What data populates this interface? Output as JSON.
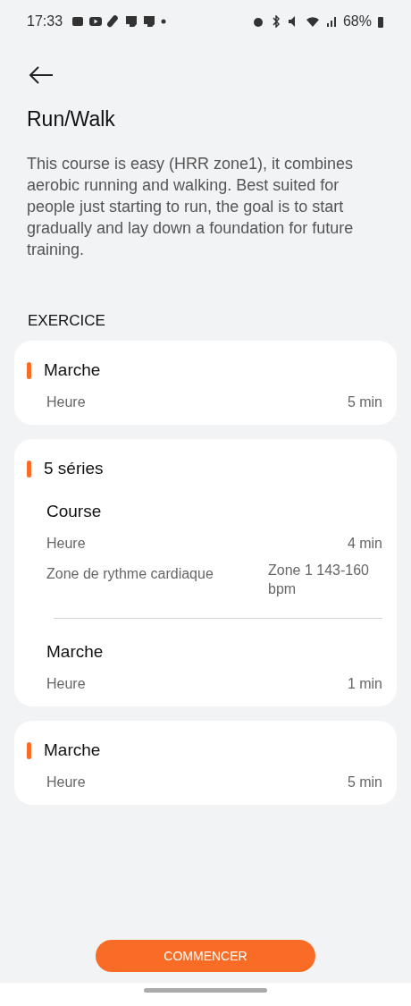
{
  "status_bar": {
    "time": "17:33",
    "battery": "68%"
  },
  "title": "Run/Walk",
  "description": "This course is easy (HRR zone1), it combines aerobic running and walking. Best suited for people just starting to run, the goal is to start gradually and lay down a foundation for future training.",
  "section": "EXERCICE",
  "blocks": [
    {
      "kind": "step",
      "title": "Marche",
      "rows": [
        {
          "label": "Heure",
          "value": "5 min"
        }
      ]
    },
    {
      "kind": "repeat",
      "title": "5 séries",
      "steps": [
        {
          "title": "Course",
          "rows": [
            {
              "label": "Heure",
              "value": "4 min"
            },
            {
              "label": "Zone de rythme cardiaque",
              "value": "Zone 1 143-160 bpm"
            }
          ]
        },
        {
          "title": "Marche",
          "rows": [
            {
              "label": "Heure",
              "value": "1 min"
            }
          ]
        }
      ]
    },
    {
      "kind": "step",
      "title": "Marche",
      "rows": [
        {
          "label": "Heure",
          "value": "5 min"
        }
      ]
    }
  ],
  "button": "COMMENCER"
}
